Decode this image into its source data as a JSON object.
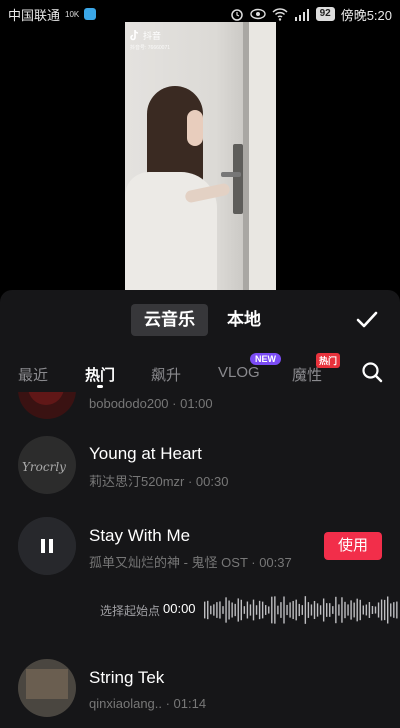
{
  "status_bar": {
    "carrier": "中国联通",
    "battery": "92",
    "time_label": "傍晚5:20"
  },
  "video": {
    "brand": "抖音",
    "account_id": "抖音号: 76660071"
  },
  "sheet": {
    "toggle": [
      {
        "label": "云音乐",
        "active": true
      },
      {
        "label": "本地",
        "active": false
      }
    ],
    "tabs": [
      {
        "label": "最近",
        "active": false
      },
      {
        "label": "热门",
        "active": true
      },
      {
        "label": "飙升",
        "active": false
      },
      {
        "label": "VLOG",
        "active": false,
        "badge": "NEW"
      },
      {
        "label": "魔性",
        "active": false,
        "badge": "热门"
      }
    ],
    "tracks": [
      {
        "title": "",
        "subtitle": "bobododo200 · 01:00"
      },
      {
        "title": "Young at Heart",
        "subtitle": "莉达思汀520mzr · 00:30"
      },
      {
        "title": "Stay With Me",
        "subtitle": "孤单又灿烂的神 - 鬼怪 OST · 00:37",
        "playing": true,
        "use_label": "使用"
      },
      {
        "title": "String Tek",
        "subtitle": "qinxiaolang.. · 01:14"
      }
    ],
    "waveform": {
      "label": "选择起始点",
      "time": "00:00"
    }
  }
}
